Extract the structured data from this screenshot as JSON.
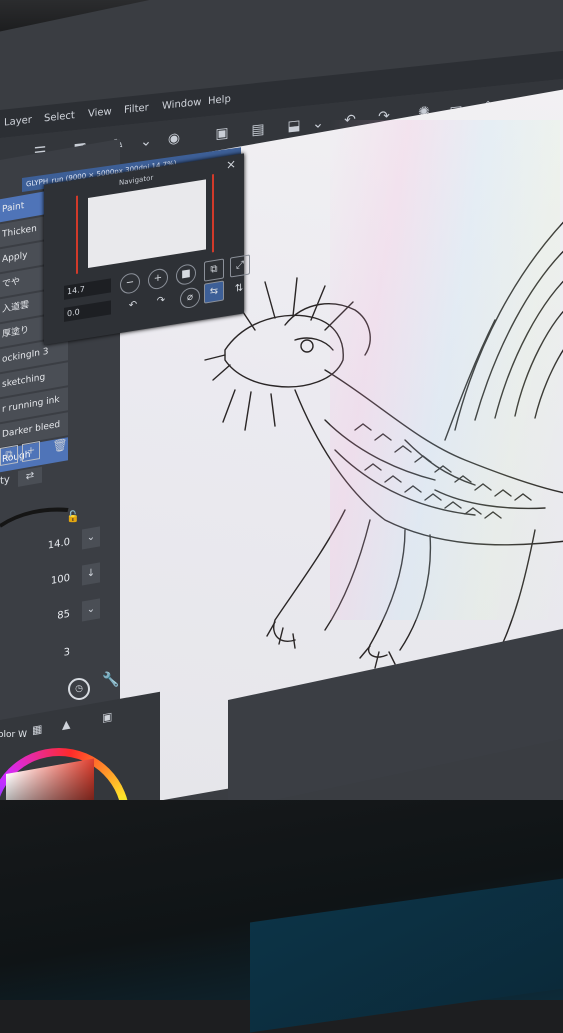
{
  "menu": {
    "items": [
      "Layer",
      "Select",
      "View",
      "Filter",
      "Window",
      "Help"
    ]
  },
  "document_tab": {
    "title": "GLYPH_run (9000 × 5000px 300dpi 14.7%)"
  },
  "navigator": {
    "title": "Navigator",
    "zoom_value": "14.7",
    "angle_value": "0.0"
  },
  "brush_list": {
    "items": [
      "Paint",
      "Thicken",
      "Apply",
      "でや",
      "入道雲",
      "厚塗り",
      "ockingIn 3",
      "sketching",
      "r running ink",
      "Darker bleed",
      "Rough"
    ],
    "selected": "Rough"
  },
  "tool_property": {
    "tab_label": "ty",
    "brush_size": "14.0",
    "opacity": "100",
    "density": "85",
    "stabilization": "3"
  },
  "color_panel": {
    "mode_label": "olor W",
    "keys": [
      "H",
      "S",
      "V"
    ],
    "current_color": "#e04030"
  },
  "icons": {
    "menu": "hamburger-icon",
    "undo": "undo-icon",
    "redo": "redo-icon",
    "save": "save-icon"
  }
}
